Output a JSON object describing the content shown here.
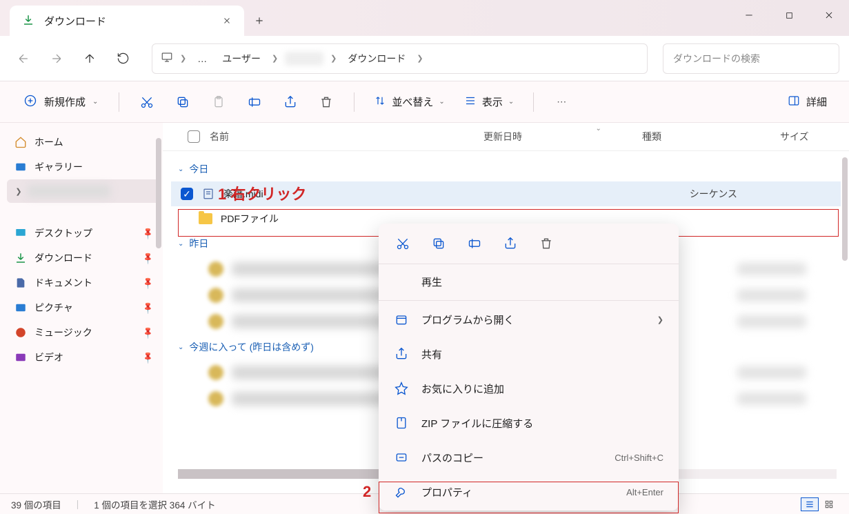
{
  "tab": {
    "title": "ダウンロード"
  },
  "breadcrumbs": {
    "items": [
      "ユーザー",
      "ダウンロード"
    ],
    "ellipsis": "…"
  },
  "search": {
    "placeholder": "ダウンロードの検索"
  },
  "toolbar": {
    "new_label": "新規作成",
    "sort_label": "並べ替え",
    "view_label": "表示",
    "details_label": "詳細"
  },
  "sidebar": {
    "home": "ホーム",
    "gallery": "ギャラリー",
    "desktop": "デスクトップ",
    "downloads": "ダウンロード",
    "documents": "ドキュメント",
    "pictures": "ピクチャ",
    "music": "ミュージック",
    "videos": "ビデオ"
  },
  "columns": {
    "name": "名前",
    "date": "更新日時",
    "type": "種類",
    "size": "サイズ"
  },
  "groups": {
    "today": "今日",
    "yesterday": "昨日",
    "thisweek": "今週に入って (昨日は含めず)"
  },
  "files": {
    "midi_name": "楽譜.midi",
    "midi_type_partial": "シーケンス",
    "pdf_folder": "PDFファイル"
  },
  "context_menu": {
    "play": "再生",
    "open_with": "プログラムから開く",
    "share": "共有",
    "favorite": "お気に入りに追加",
    "zip": "ZIP ファイルに圧縮する",
    "copy_path": "パスのコピー",
    "copy_path_sc": "Ctrl+Shift+C",
    "properties": "プロパティ",
    "properties_sc": "Alt+Enter"
  },
  "annotations": {
    "a1": "1 右クリック",
    "a2": "2"
  },
  "status": {
    "count": "39 個の項目",
    "selection": "1 個の項目を選択 364 バイト"
  }
}
